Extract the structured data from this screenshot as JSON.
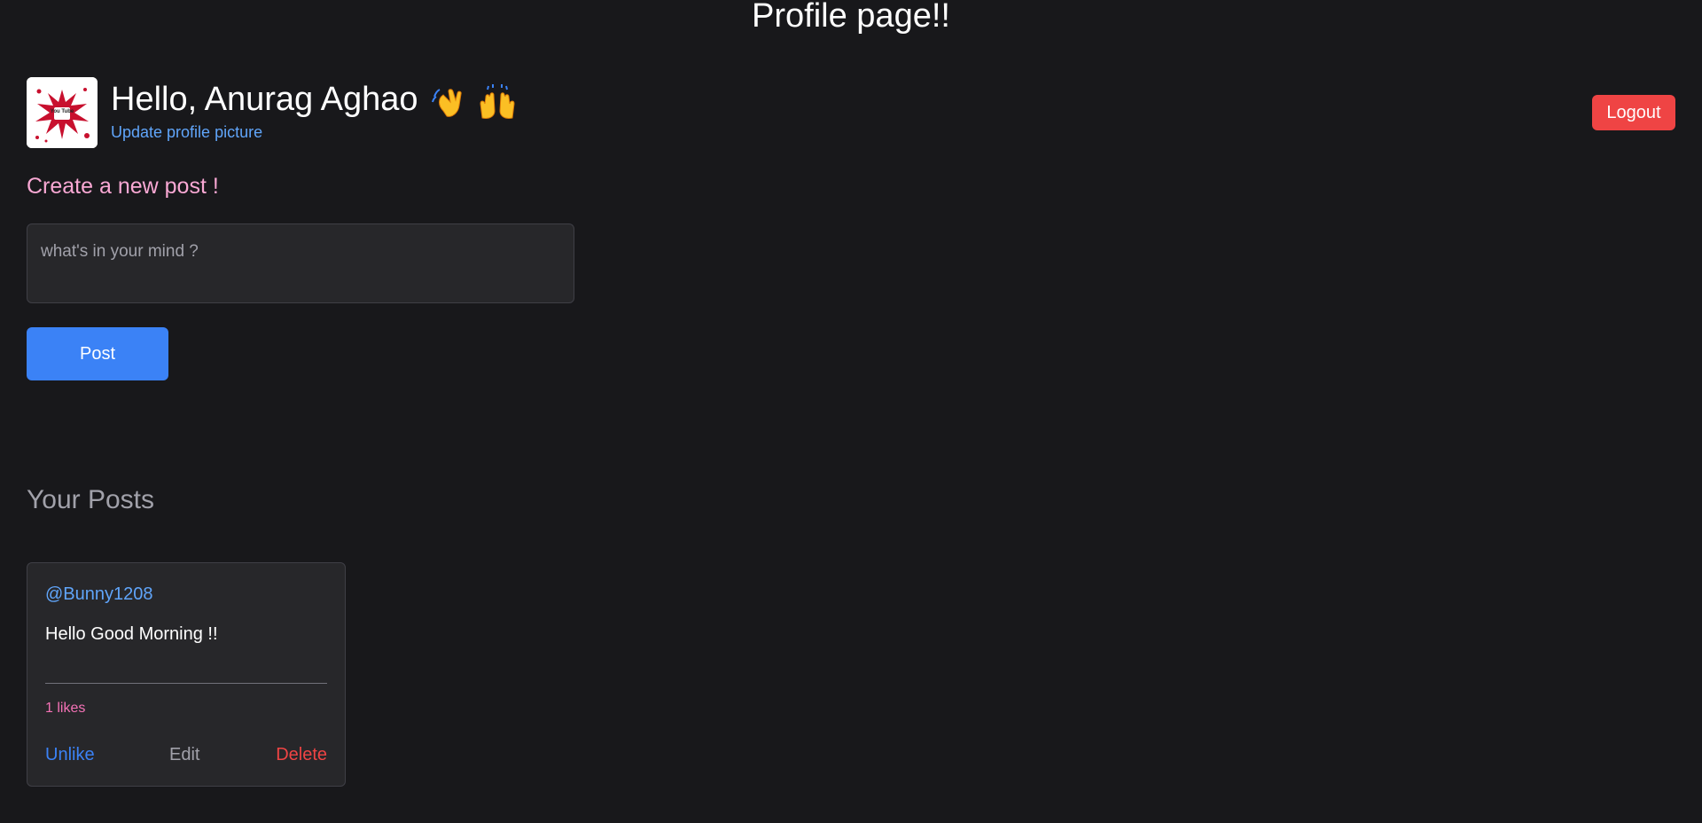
{
  "page": {
    "title": "Profile page!!"
  },
  "header": {
    "greeting": "Hello, Anurag Aghao",
    "emojis": "👋 🙌",
    "update_picture_link": "Update profile picture",
    "logout_label": "Logout",
    "avatar_icon": "youtube-splash-logo",
    "avatar_logo_text": "You Tube"
  },
  "create_post": {
    "heading": "Create a new post !",
    "placeholder": "what's in your mind ?",
    "value": "",
    "post_button_label": "Post"
  },
  "posts_section": {
    "heading": "Your Posts",
    "posts": [
      {
        "username": "@Bunny1208",
        "content": "Hello Good Morning !!",
        "likes": "1 likes",
        "actions": {
          "unlike": "Unlike",
          "edit": "Edit",
          "delete": "Delete"
        }
      }
    ]
  },
  "colors": {
    "background": "#18181b",
    "accent_blue": "#3b82f6",
    "link_blue": "#60a5fa",
    "danger_red": "#ef4444",
    "pink_heading": "#f9a8d4",
    "likes_pink": "#f472b6",
    "card_bg": "#27272a"
  }
}
